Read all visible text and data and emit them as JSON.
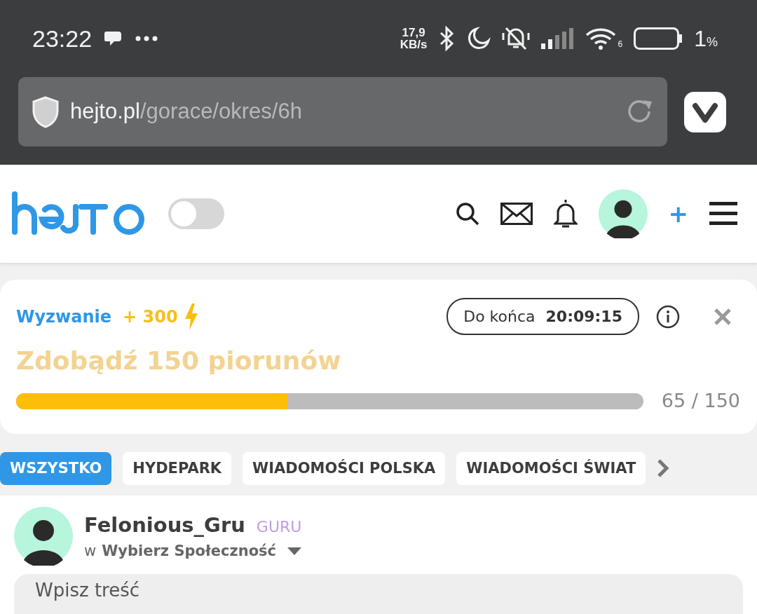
{
  "status_bar": {
    "time": "23:22",
    "net_speed": "17,9",
    "net_unit": "KB/s",
    "wifi_band": "6",
    "battery_percent": "1",
    "battery_unit": "%"
  },
  "browser": {
    "url_host": "hejto.pl",
    "url_path": "/gorace/okres/6h"
  },
  "header": {
    "dark_mode": {
      "on": false
    },
    "add": "+"
  },
  "challenge": {
    "label": "Wyzwanie",
    "reward": "+ 300",
    "countdown_label": "Do końca",
    "countdown": "20:09:15",
    "title": "Zdobądź 150 piorunów",
    "level": 0.433,
    "reading": "65 / 150"
  },
  "tabs": [
    {
      "label": "WSZYSTKO",
      "selected": true
    },
    {
      "label": "HYDEPARK",
      "selected": false
    },
    {
      "label": "WIADOMOŚCI POLSKA",
      "selected": false
    },
    {
      "label": "WIADOMOŚCI ŚWIAT",
      "selected": false
    }
  ],
  "post": {
    "author": "Felonious_Gru",
    "rank": "GURU",
    "prefix": "w",
    "community": "Wybierz Społeczność",
    "placeholder": "Wpisz treść"
  }
}
